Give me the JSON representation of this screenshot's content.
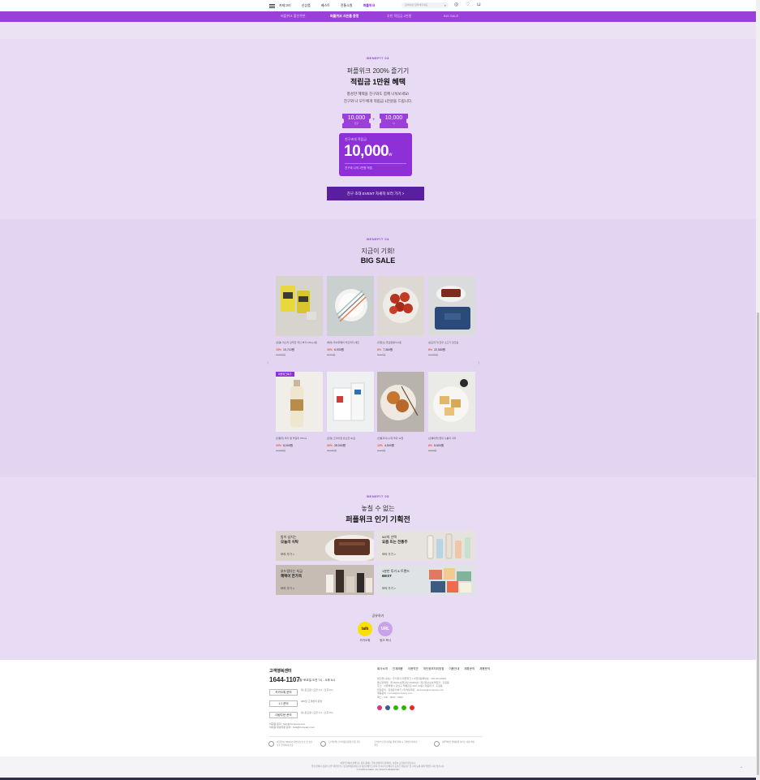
{
  "header": {
    "nav": [
      "카테고리",
      "신상품",
      "베스트",
      "전통소원",
      "퍼플위크"
    ],
    "active_nav": "퍼플위크",
    "search_placeholder": "검색어를 입력해주세요"
  },
  "subnav": {
    "tabs": [
      "퍼플위크 할인쿠폰",
      "퍼플위크 사은품 증정",
      "추천 적립금 2만원",
      "BIG SALE"
    ],
    "active": "퍼플위크 사은품 증정"
  },
  "benefit3": {
    "label": "BENEFIT 03",
    "title1": "퍼플위크 200% 즐기기",
    "title2": "적립금 1만원 혜택",
    "desc1": "풍성한 혜택을 친구와도 함께 나눠보세요!",
    "desc2": "친구와 나 모두에게 적립금 1만원을 드립니다.",
    "coupon_left_amount": "10,000",
    "coupon_left_who": "친구",
    "coupon_right_amount": "10,000",
    "coupon_right_who": "나",
    "plus": "+",
    "card_caption": "친구초대 적립금",
    "card_amount": "10,000",
    "card_unit": "w",
    "card_note": "친구와 나의 1만원 적립",
    "cta": "친구 초대 EVENT 자세히 보러 가기 >"
  },
  "benefit4": {
    "label": "BENEFIT 04",
    "title1": "지금이 기회!",
    "title2": "BIG SALE",
    "products": [
      {
        "name": "[일광] 이스리 납작한 국산 부각 150g 2종",
        "discount": "15%",
        "price": "10,710원",
        "orig": "12,600원",
        "badge": ""
      },
      {
        "name": "[헤이] 테이블웨어 커트러리 세트",
        "discount": "30%",
        "price": "6,930원",
        "orig": "9,900원",
        "badge": ""
      },
      {
        "name": "[취향소] 곶감말랭이 2종",
        "discount": "8%",
        "price": "7,360원",
        "orig": "8,000원",
        "badge": ""
      },
      {
        "name": "[남도미가] 한우 소고기 장조림",
        "discount": "8%",
        "price": "22,080원",
        "orig": "24,000원",
        "badge": ""
      },
      {
        "name": "[전통주] 우리 쌀 막걸리 750ml",
        "discount": "20%",
        "price": "8,000원",
        "orig": "10,000원",
        "badge": "퍼플위크특가"
      },
      {
        "name": "[한정] 프리미엄 유산균 30포",
        "discount": "30%",
        "price": "28,000원",
        "orig": "40,000원",
        "badge": ""
      },
      {
        "name": "[전통과자] 수제 약과 12입",
        "discount": "10%",
        "price": "4,500원",
        "orig": "5,000원",
        "badge": ""
      },
      {
        "name": "[초록마을] 현미 누룽지 과자",
        "discount": "8%",
        "price": "5,500원",
        "orig": "6,000원",
        "badge": ""
      }
    ],
    "prev": "‹",
    "next": "›"
  },
  "benefit5": {
    "label": "BENEFIT 05",
    "title1": "놓칠 수 없는",
    "title2": "퍼플위크 인기 기획전",
    "banners": [
      {
        "line1": "밥이 넘치는",
        "line2": "오늘의 식탁",
        "more": "보러 가기 >"
      },
      {
        "line1": "MZ의 선택",
        "line2": "요즘 뜨는 전통주",
        "more": "보러 가기 >"
      },
      {
        "line1": "부드럽다는 지금",
        "line2": "혜택이 한가득",
        "more": "보러 가기 >"
      },
      {
        "line1": "1분만 투기 & 트렌드",
        "line2": "BEST",
        "more": "보러 가기 >"
      }
    ],
    "share_label": "공유하기",
    "share": [
      {
        "icon": "talk",
        "caption": "카카오톡"
      },
      {
        "icon": "URL",
        "caption": "링크 복사"
      }
    ]
  },
  "footer": {
    "cs_title": "고객행복센터",
    "phone": "1644-1107",
    "hours": "월~토요일 오전 7시 - 오후 6시",
    "buttons": [
      "카카오톡 문의",
      "1:1 문의",
      "대량주문 문의"
    ],
    "info": [
      "월~토요일 | 오전 7시 - 오후 6시",
      "365일 고객센터 운영",
      "업무시간 외 이용 시 순차 답변",
      "월~토요일 | 오전 7시 - 오후 6시"
    ],
    "mail1": "비회원 문의 : help@company.com",
    "mail2": "비회원 대량주문 문의 : bulk@company.com",
    "links": [
      "회사소개",
      "인재채용",
      "이용약관",
      "개인정보처리방침",
      "이용안내",
      "제휴문의",
      "채용문의"
    ],
    "company": [
      "법인명 (상호) : 주식회사 퍼플위크 | 사업자등록번호 : 000-00-00000",
      "통신판매업 : 제 0000-서울강남-00000호 | 개인정보보호책임자 : 홍길동",
      "주소 : 서울특별시 강남구 테헤란로 000, 00층 | 대표이사 : 홍길동",
      "입점문의 : 입점문의하기 | 마케팅제휴 : business@company.com",
      "채용문의 : recruit@company.com",
      "팩스 : 000 - 0000 - 0000"
    ],
    "certs": [
      "[인증번호 ISMS-P] 개인정보보호 및 정보보호 관리체계 인증",
      "[고객만족] 소비자중심경영 인증 획득",
      "고객님의 안전거래를 위해 결제 시 구매안전서비스 가입",
      "[내역확인] 결제대행 서비스 이용 확인"
    ],
    "bottom1": "퍼플위크에서 판매되는 상품 중에는 입점 판매자가 판매하는 상품이 포함되어 있습니다.",
    "bottom2": "입점 판매자 상품의 경우 퍼플위크는 통신판매중개자로서 통신판매의 당사자가 아니며 판매자가 등록한 상품정보 및 거래 등에 대해 책임을 지지 않습니다.",
    "copyright": "© PURPLE WEEK. ALL RIGHTS RESERVED",
    "top": "^"
  }
}
